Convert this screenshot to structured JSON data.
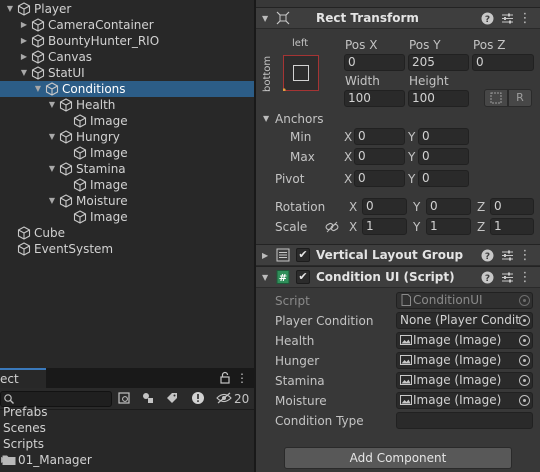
{
  "hierarchy": {
    "items": [
      {
        "label": "Player",
        "expanded": true
      },
      {
        "label": "CameraContainer",
        "expanded": false
      },
      {
        "label": "BountyHunter_RIO",
        "expanded": false
      },
      {
        "label": "Canvas",
        "expanded": false
      },
      {
        "label": "StatUI",
        "expanded": true
      },
      {
        "label": "Conditions",
        "expanded": true,
        "selected": true
      },
      {
        "label": "Health",
        "expanded": true
      },
      {
        "label": "Image"
      },
      {
        "label": "Hungry",
        "expanded": true
      },
      {
        "label": "Image"
      },
      {
        "label": "Stamina",
        "expanded": true
      },
      {
        "label": "Image"
      },
      {
        "label": "Moisture",
        "expanded": true
      },
      {
        "label": "Image"
      },
      {
        "label": "Cube"
      },
      {
        "label": "EventSystem"
      }
    ]
  },
  "project": {
    "tab_label": "ect",
    "hidden_count": "20",
    "items": [
      "Prefabs",
      "Scenes",
      "Scripts",
      "01_Manager"
    ]
  },
  "rect_transform": {
    "title": "Rect Transform",
    "anchor_preset_top": "left",
    "anchor_preset_side": "bottom",
    "pos_x_label": "Pos X",
    "pos_y_label": "Pos Y",
    "pos_z_label": "Pos Z",
    "pos_x": "0",
    "pos_y": "205",
    "pos_z": "0",
    "width_label": "Width",
    "height_label": "Height",
    "width": "100",
    "height": "100",
    "raw_button": "R",
    "anchors_label": "Anchors",
    "min_label": "Min",
    "max_label": "Max",
    "pivot_label": "Pivot",
    "anchor_min_x": "0",
    "anchor_min_y": "0",
    "anchor_max_x": "0",
    "anchor_max_y": "0",
    "pivot_x": "0",
    "pivot_y": "0",
    "rotation_label": "Rotation",
    "scale_label": "Scale",
    "rotation_x": "0",
    "rotation_y": "0",
    "rotation_z": "0",
    "scale_x": "1",
    "scale_y": "1",
    "scale_z": "1",
    "axis_x": "X",
    "axis_y": "Y",
    "axis_z": "Z"
  },
  "vertical_layout_group": {
    "title": "Vertical Layout Group",
    "enabled": true
  },
  "condition_ui": {
    "title": "Condition UI (Script)",
    "enabled": true,
    "fields": [
      {
        "label": "Script",
        "value": "ConditionUI",
        "dim": true
      },
      {
        "label": "Player Condition",
        "value": "None (Player Condit"
      },
      {
        "label": "Health",
        "value": "Image (Image)"
      },
      {
        "label": "Hunger",
        "value": "Image (Image)"
      },
      {
        "label": "Stamina",
        "value": "Image (Image)"
      },
      {
        "label": "Moisture",
        "value": "Image (Image)"
      },
      {
        "label": "Condition Type",
        "value": ""
      }
    ]
  },
  "add_component_label": "Add Component",
  "colors": {
    "selection": "#2c5d87",
    "panel": "#282828",
    "inspector": "#383838",
    "accent_tab": "#3a79bb"
  }
}
